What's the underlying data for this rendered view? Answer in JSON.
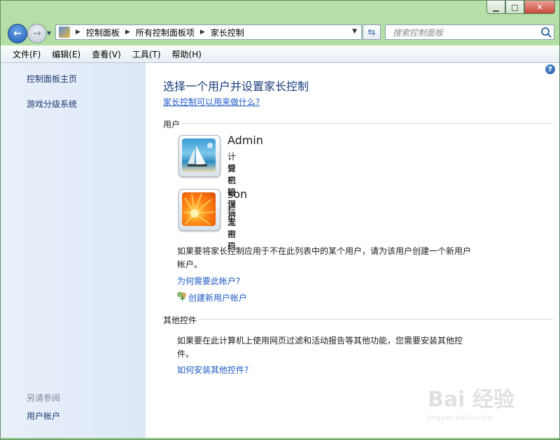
{
  "window": {
    "controls": {
      "minimize_icon": "minimize-icon",
      "maximize_icon": "maximize-icon",
      "close_icon": "close-icon"
    }
  },
  "navbar": {
    "breadcrumbs": [
      "控制面板",
      "所有控制面板项",
      "家长控制"
    ],
    "search_placeholder": "搜索控制面板"
  },
  "menu": [
    "文件(F)",
    "编辑(E)",
    "查看(V)",
    "工具(T)",
    "帮助(H)"
  ],
  "sidebar": {
    "links": [
      "控制面板主页",
      "游戏分级系统"
    ],
    "see_also_heading": "另请参阅",
    "see_also_links": [
      "用户帐户"
    ]
  },
  "main": {
    "title": "选择一个用户并设置家长控制",
    "what_link": "家长控制可以用来做什么?",
    "users_section": "用户",
    "users": [
      {
        "name": "Admin",
        "role": "计算机管理员",
        "password": "受密码保护",
        "picture": "beach-sailboat"
      },
      {
        "name": "son",
        "role": "标准用户",
        "password": "无密码",
        "picture": "orange-flower"
      }
    ],
    "create_hint": "如果要将家长控制应用于不在此列表中的某个用户，请为该用户创建一个新用户帐户。",
    "why_link": "为何需要此帐户?",
    "create_link": "创建新用户帐户",
    "other_section": "其他控件",
    "other_hint": "如果要在此计算机上使用网页过滤和活动报告等其他功能，您需要安装其他控件。",
    "install_link": "如何安装其他控件?"
  },
  "watermark": {
    "logo": "Bai 经验",
    "url": "jingyan.baidu.com"
  }
}
